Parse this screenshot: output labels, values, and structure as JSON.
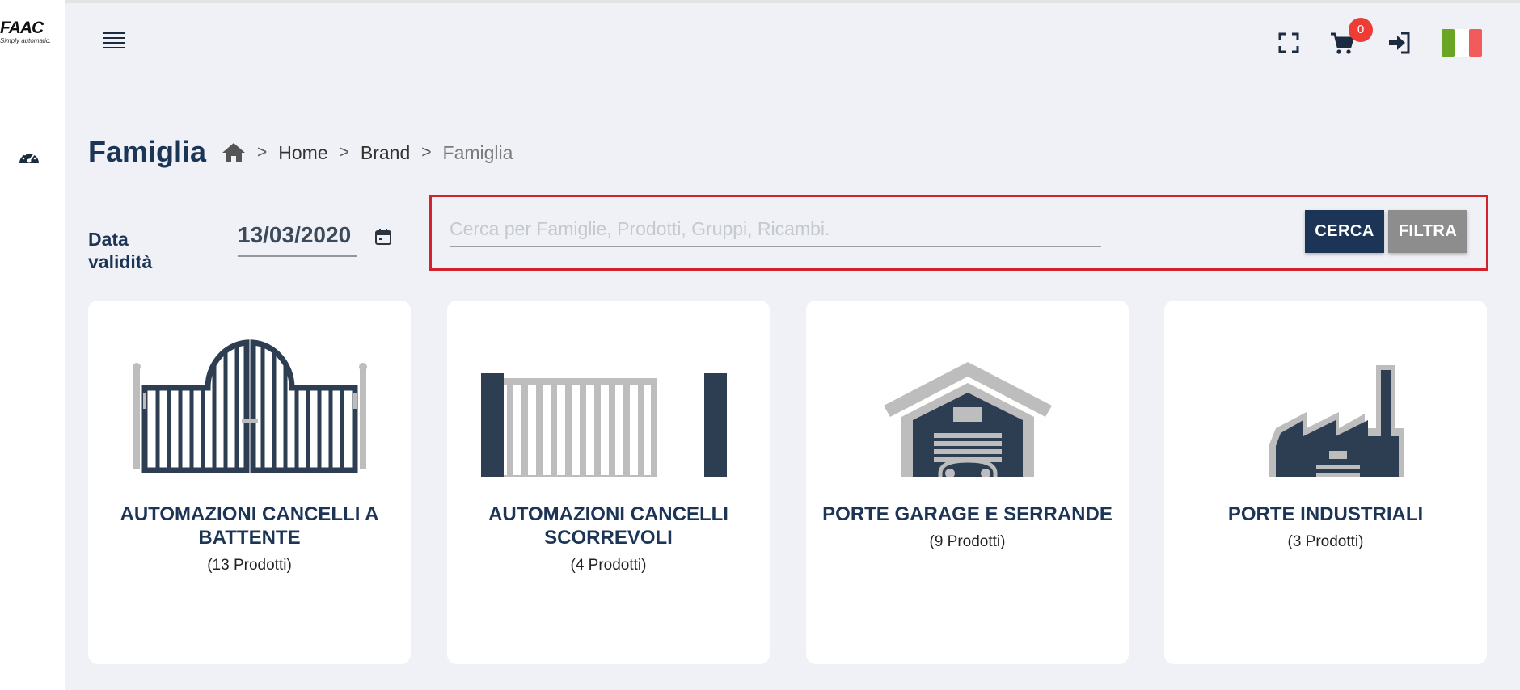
{
  "brand": {
    "logo_text": "FAAC",
    "logo_tagline": "Simply automatic."
  },
  "header": {
    "cart_count": "0",
    "icons": [
      "menu-icon",
      "fullscreen-icon",
      "cart-icon",
      "login-icon",
      "italy-flag-icon"
    ],
    "colors": {
      "navy": "#1c3556",
      "badge": "#ef3d35",
      "flag_green": "#6aa623",
      "flag_red": "#f15b5c",
      "highlight": "#d2232d"
    }
  },
  "sidebar": {
    "icons": [
      "dashboard-icon"
    ]
  },
  "page": {
    "title": "Famiglia",
    "breadcrumb": [
      {
        "label": "Home"
      },
      {
        "label": "Brand"
      },
      {
        "label": "Famiglia"
      }
    ]
  },
  "filters": {
    "date_label": "Data validità",
    "date_value": "13/03/2020",
    "search_placeholder": "Cerca per Famiglie, Prodotti, Gruppi, Ricambi.",
    "search_value": "",
    "search_button": "CERCA",
    "filter_button": "FILTRA"
  },
  "families": [
    {
      "title": "AUTOMAZIONI CANCELLI A BATTENTE",
      "count": "(13 Prodotti)",
      "icon": "swing-gate-icon"
    },
    {
      "title": "AUTOMAZIONI CANCELLI SCORREVOLI",
      "count": "(4 Prodotti)",
      "icon": "sliding-gate-icon"
    },
    {
      "title": "PORTE GARAGE E SERRANDE",
      "count": "(9 Prodotti)",
      "icon": "garage-icon"
    },
    {
      "title": "PORTE INDUSTRIALI",
      "count": "(3 Prodotti)",
      "icon": "factory-icon"
    }
  ]
}
